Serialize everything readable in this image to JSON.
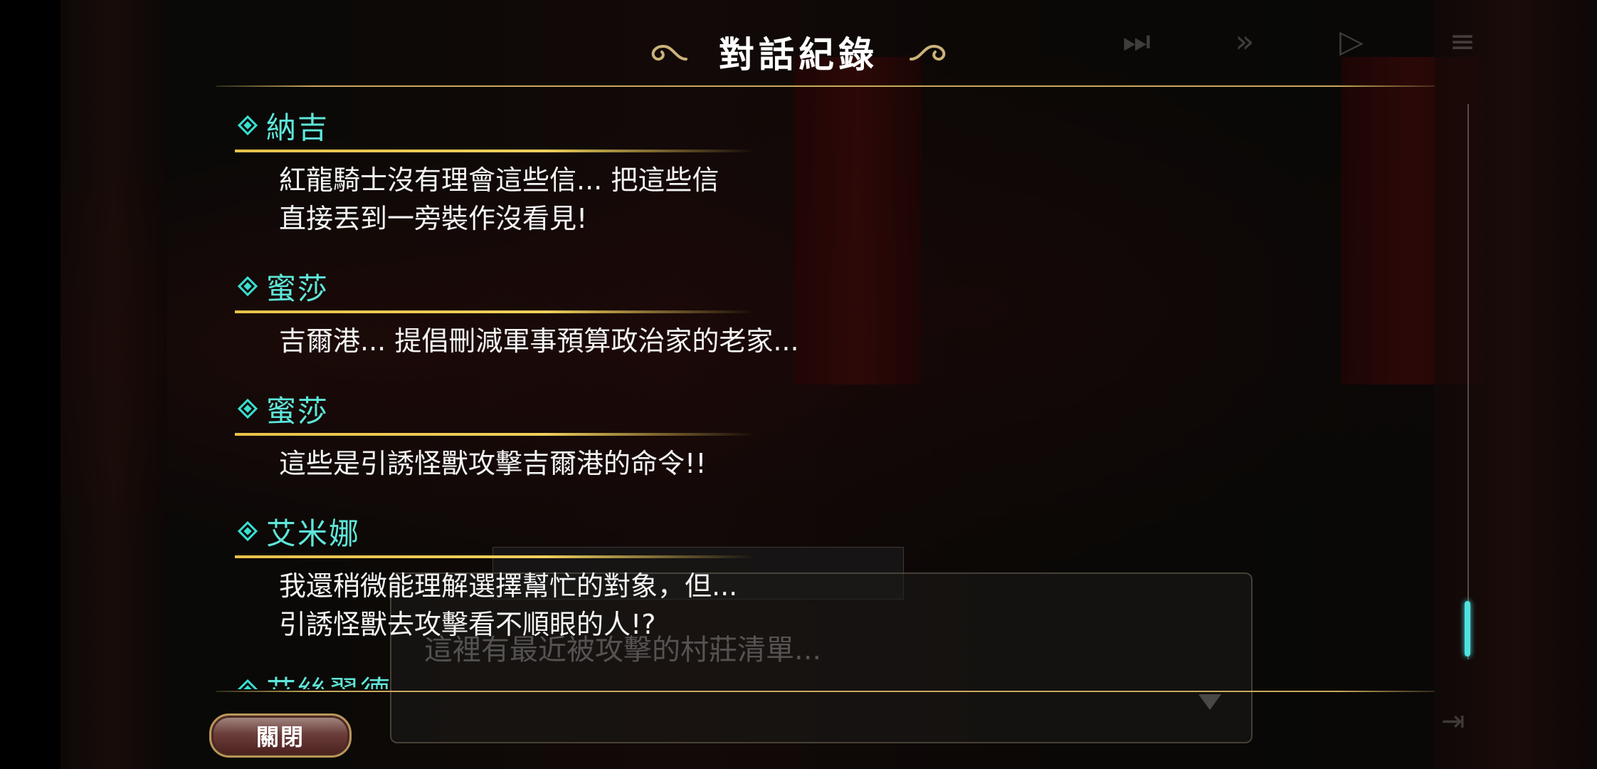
{
  "log": {
    "title": "對話紀錄",
    "close_label": "關閉",
    "entries": [
      {
        "speaker": "納吉",
        "lines": [
          "紅龍騎士沒有理會這些信... 把這些信",
          "直接丟到一旁裝作沒看見!"
        ]
      },
      {
        "speaker": "蜜莎",
        "lines": [
          "吉爾港... 提倡刪減軍事預算政治家的老家..."
        ]
      },
      {
        "speaker": "蜜莎",
        "lines": [
          "這些是引誘怪獸攻擊吉爾港的命令!!"
        ]
      },
      {
        "speaker": "艾米娜",
        "lines": [
          "我還稍微能理解選擇幫忙的對象，但...",
          "引誘怪獸去攻擊看不順眼的人!?"
        ]
      },
      {
        "speaker": "艾絲翠德",
        "lines": []
      }
    ]
  },
  "background_dialogue": {
    "text": "這裡有最近被攻擊的村莊清單..."
  },
  "game_controls": {
    "skip": "skip-icon",
    "fast_forward": "fast-forward-icon",
    "auto": "auto-icon",
    "log": "log-icon"
  },
  "colors": {
    "speaker": "#5ee7da",
    "accent_gold": "#e8c24a",
    "scroll_thumb": "#4fe3e0"
  },
  "scroll_position": 0.92
}
